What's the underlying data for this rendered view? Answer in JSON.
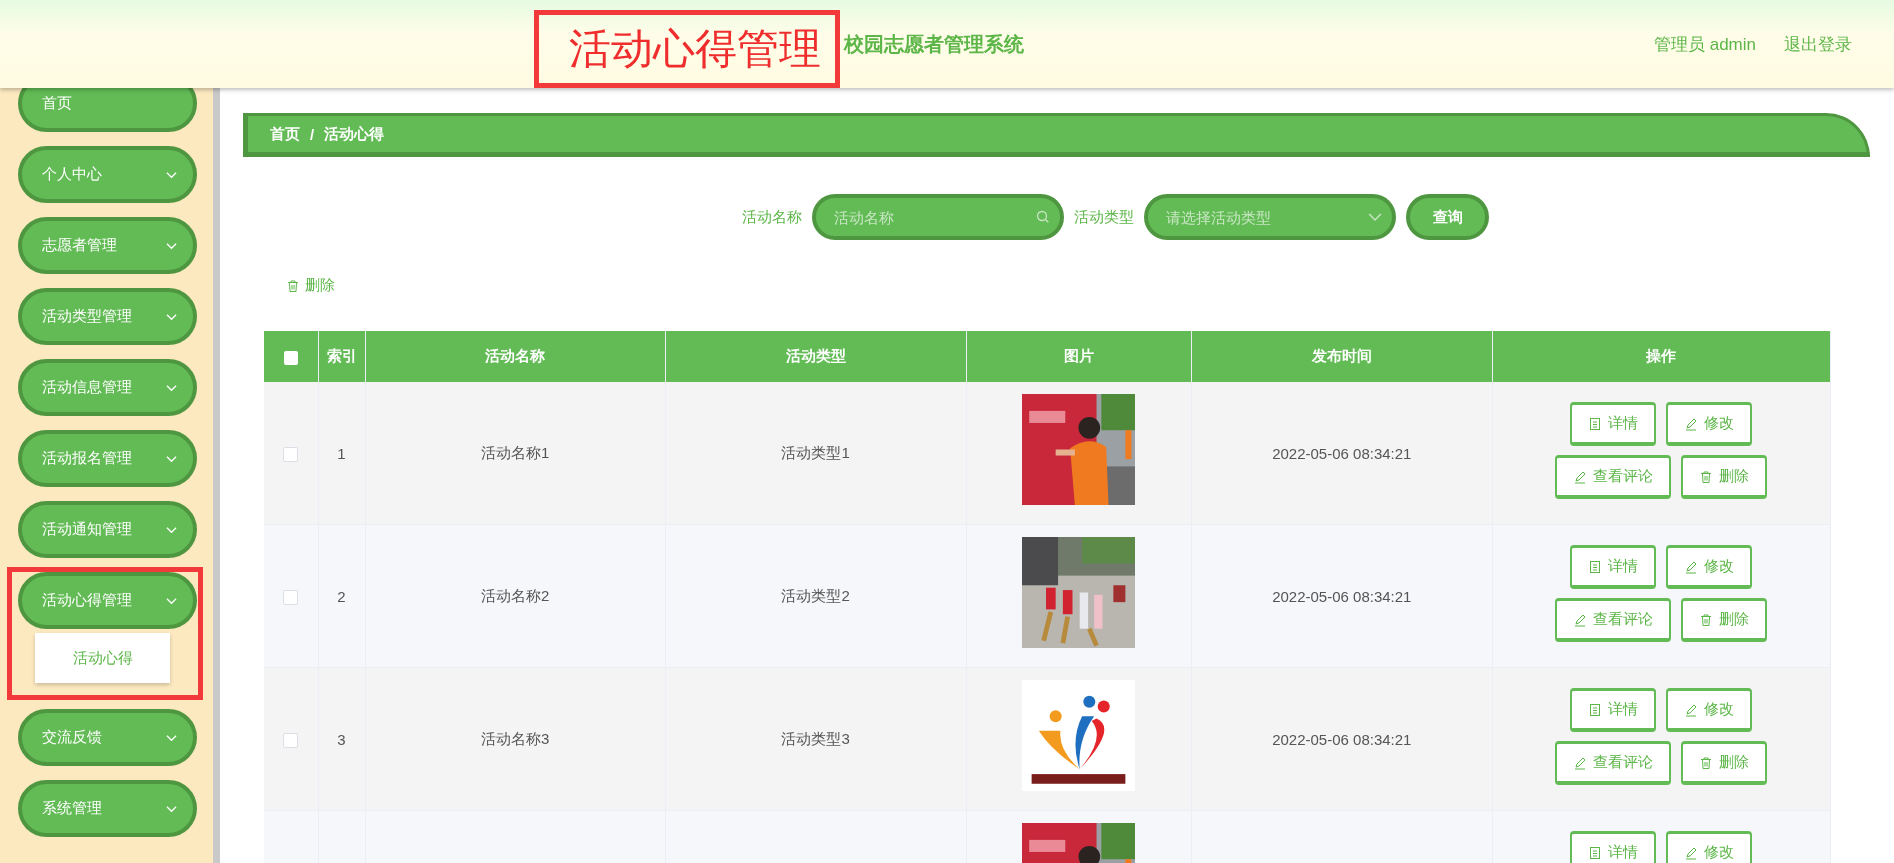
{
  "header": {
    "page_title": "活动心得管理",
    "page_title_highlighted": true,
    "system_name": "校园志愿者管理系统",
    "user": "管理员 admin",
    "logout": "退出登录"
  },
  "sidebar": {
    "items": [
      {
        "label": "首页",
        "expandable": false,
        "highlighted": false
      },
      {
        "label": "个人中心",
        "expandable": true,
        "expanded": false,
        "highlighted": false
      },
      {
        "label": "志愿者管理",
        "expandable": true,
        "expanded": false,
        "highlighted": false
      },
      {
        "label": "活动类型管理",
        "expandable": true,
        "expanded": false,
        "highlighted": false
      },
      {
        "label": "活动信息管理",
        "expandable": true,
        "expanded": false,
        "highlighted": false
      },
      {
        "label": "活动报名管理",
        "expandable": true,
        "expanded": false,
        "highlighted": false
      },
      {
        "label": "活动通知管理",
        "expandable": true,
        "expanded": false,
        "highlighted": false
      },
      {
        "label": "活动心得管理",
        "expandable": true,
        "expanded": true,
        "highlighted": true,
        "children": [
          {
            "label": "活动心得"
          }
        ]
      },
      {
        "label": "交流反馈",
        "expandable": true,
        "expanded": false,
        "highlighted": false
      },
      {
        "label": "系统管理",
        "expandable": true,
        "expanded": false,
        "highlighted": false
      }
    ]
  },
  "breadcrumb": {
    "items": [
      "首页",
      "活动心得"
    ],
    "separator": "/"
  },
  "search": {
    "fields": [
      {
        "kind": "text",
        "label": "活动名称",
        "placeholder": "活动名称"
      },
      {
        "kind": "select",
        "label": "活动类型",
        "placeholder": "请选择活动类型"
      }
    ],
    "button": "查询"
  },
  "toolbar": {
    "delete": "删除"
  },
  "table": {
    "select_all_checked": false,
    "columns": [
      "索引",
      "活动名称",
      "活动类型",
      "图片",
      "发布时间",
      "操作"
    ],
    "rows": [
      {
        "selected": false,
        "index": "1",
        "name": "活动名称1",
        "type": "活动类型1",
        "time": "2022-05-06 08:34:21",
        "actions": [
          {
            "kind": "detail",
            "label": "详情"
          },
          {
            "kind": "edit",
            "label": "修改"
          },
          {
            "kind": "comments",
            "label": "查看评论"
          },
          {
            "kind": "delete",
            "label": "删除"
          }
        ]
      },
      {
        "selected": false,
        "index": "2",
        "name": "活动名称2",
        "type": "活动类型2",
        "time": "2022-05-06 08:34:21",
        "actions": [
          {
            "kind": "detail",
            "label": "详情"
          },
          {
            "kind": "edit",
            "label": "修改"
          },
          {
            "kind": "comments",
            "label": "查看评论"
          },
          {
            "kind": "delete",
            "label": "删除"
          }
        ]
      },
      {
        "selected": false,
        "index": "3",
        "name": "活动名称3",
        "type": "活动类型3",
        "time": "2022-05-06 08:34:21",
        "actions": [
          {
            "kind": "detail",
            "label": "详情"
          },
          {
            "kind": "edit",
            "label": "修改"
          },
          {
            "kind": "comments",
            "label": "查看评论"
          },
          {
            "kind": "delete",
            "label": "删除"
          }
        ]
      },
      {
        "actions": [
          {
            "kind": "detail",
            "label": "详情"
          },
          {
            "kind": "edit",
            "label": "修改"
          }
        ]
      }
    ]
  }
}
